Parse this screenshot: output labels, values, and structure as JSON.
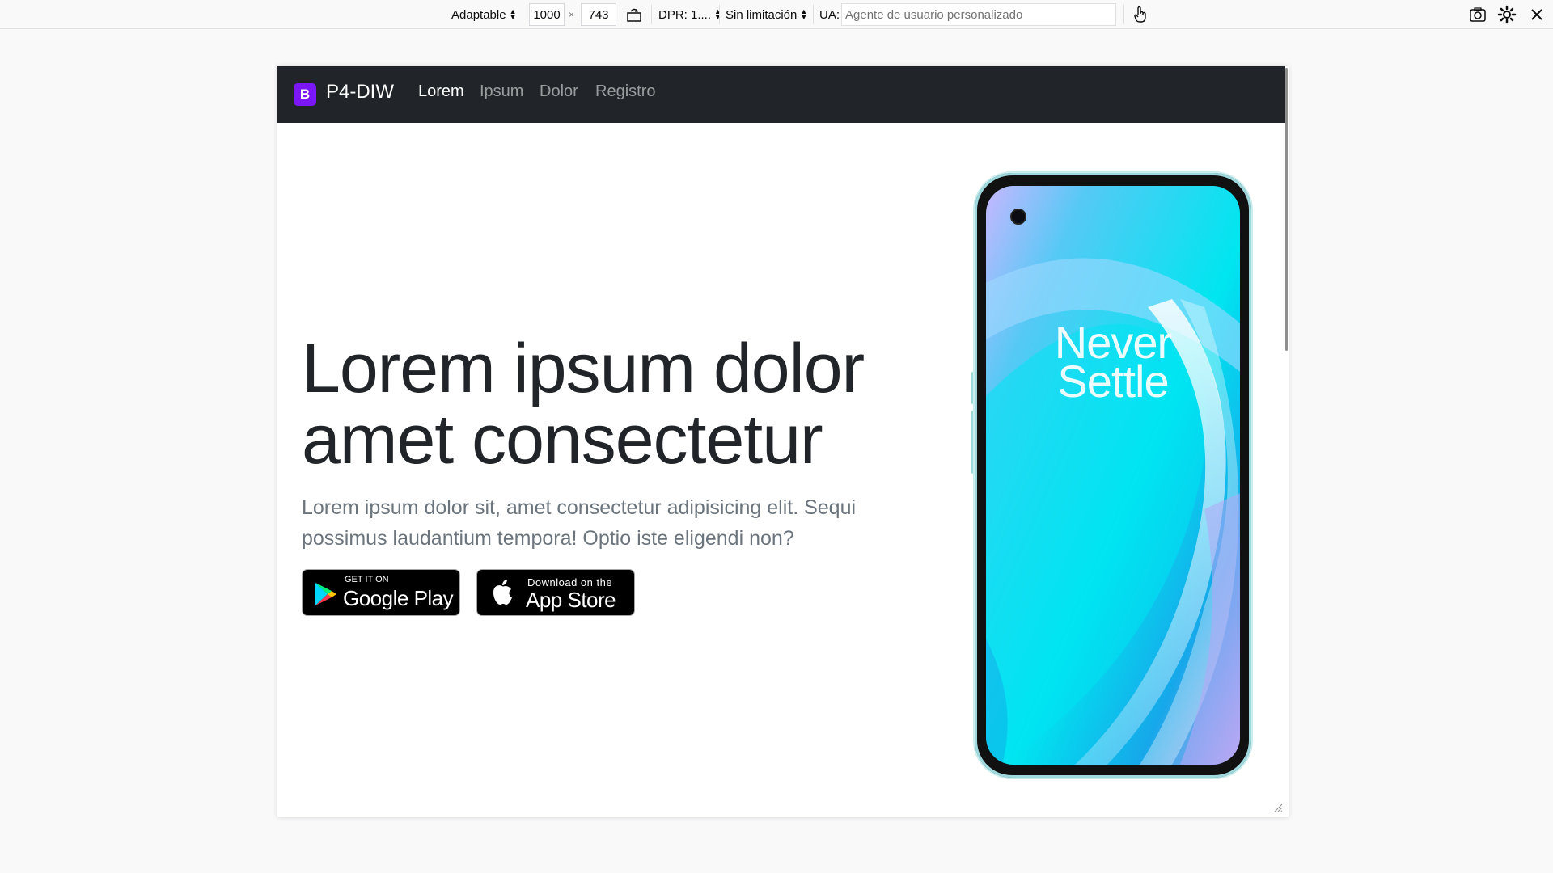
{
  "toolbar": {
    "device_label": "Adaptable",
    "width": "1000",
    "height": "743",
    "times": "×",
    "dpr_label": "DPR: 1....",
    "throttle_label": "Sin limitación",
    "ua_label": "UA:",
    "ua_placeholder": "Agente de usuario personalizado"
  },
  "navbar": {
    "logo_letter": "B",
    "brand": "P4-DIW",
    "links": [
      {
        "label": "Lorem",
        "active": true
      },
      {
        "label": "Ipsum",
        "active": false
      },
      {
        "label": "Dolor",
        "active": false
      },
      {
        "label": "Registro",
        "active": false
      }
    ],
    "bg_color": "#212529",
    "logo_color": "#7b16f7"
  },
  "hero": {
    "title_line1": "Lorem ipsum dolor",
    "title_line2": "amet consectetur",
    "lead_line1": "Lorem ipsum dolor sit, amet consectetur adipisicing elit. Sequi",
    "lead_line2": "possimus laudantium tempora! Optio iste eligendi non?",
    "google_play": {
      "small": "GET IT ON",
      "big": "Google Play"
    },
    "app_store": {
      "small": "Download on the",
      "big": "App Store"
    }
  },
  "phone": {
    "line1": "Never",
    "line2": "Settle"
  }
}
